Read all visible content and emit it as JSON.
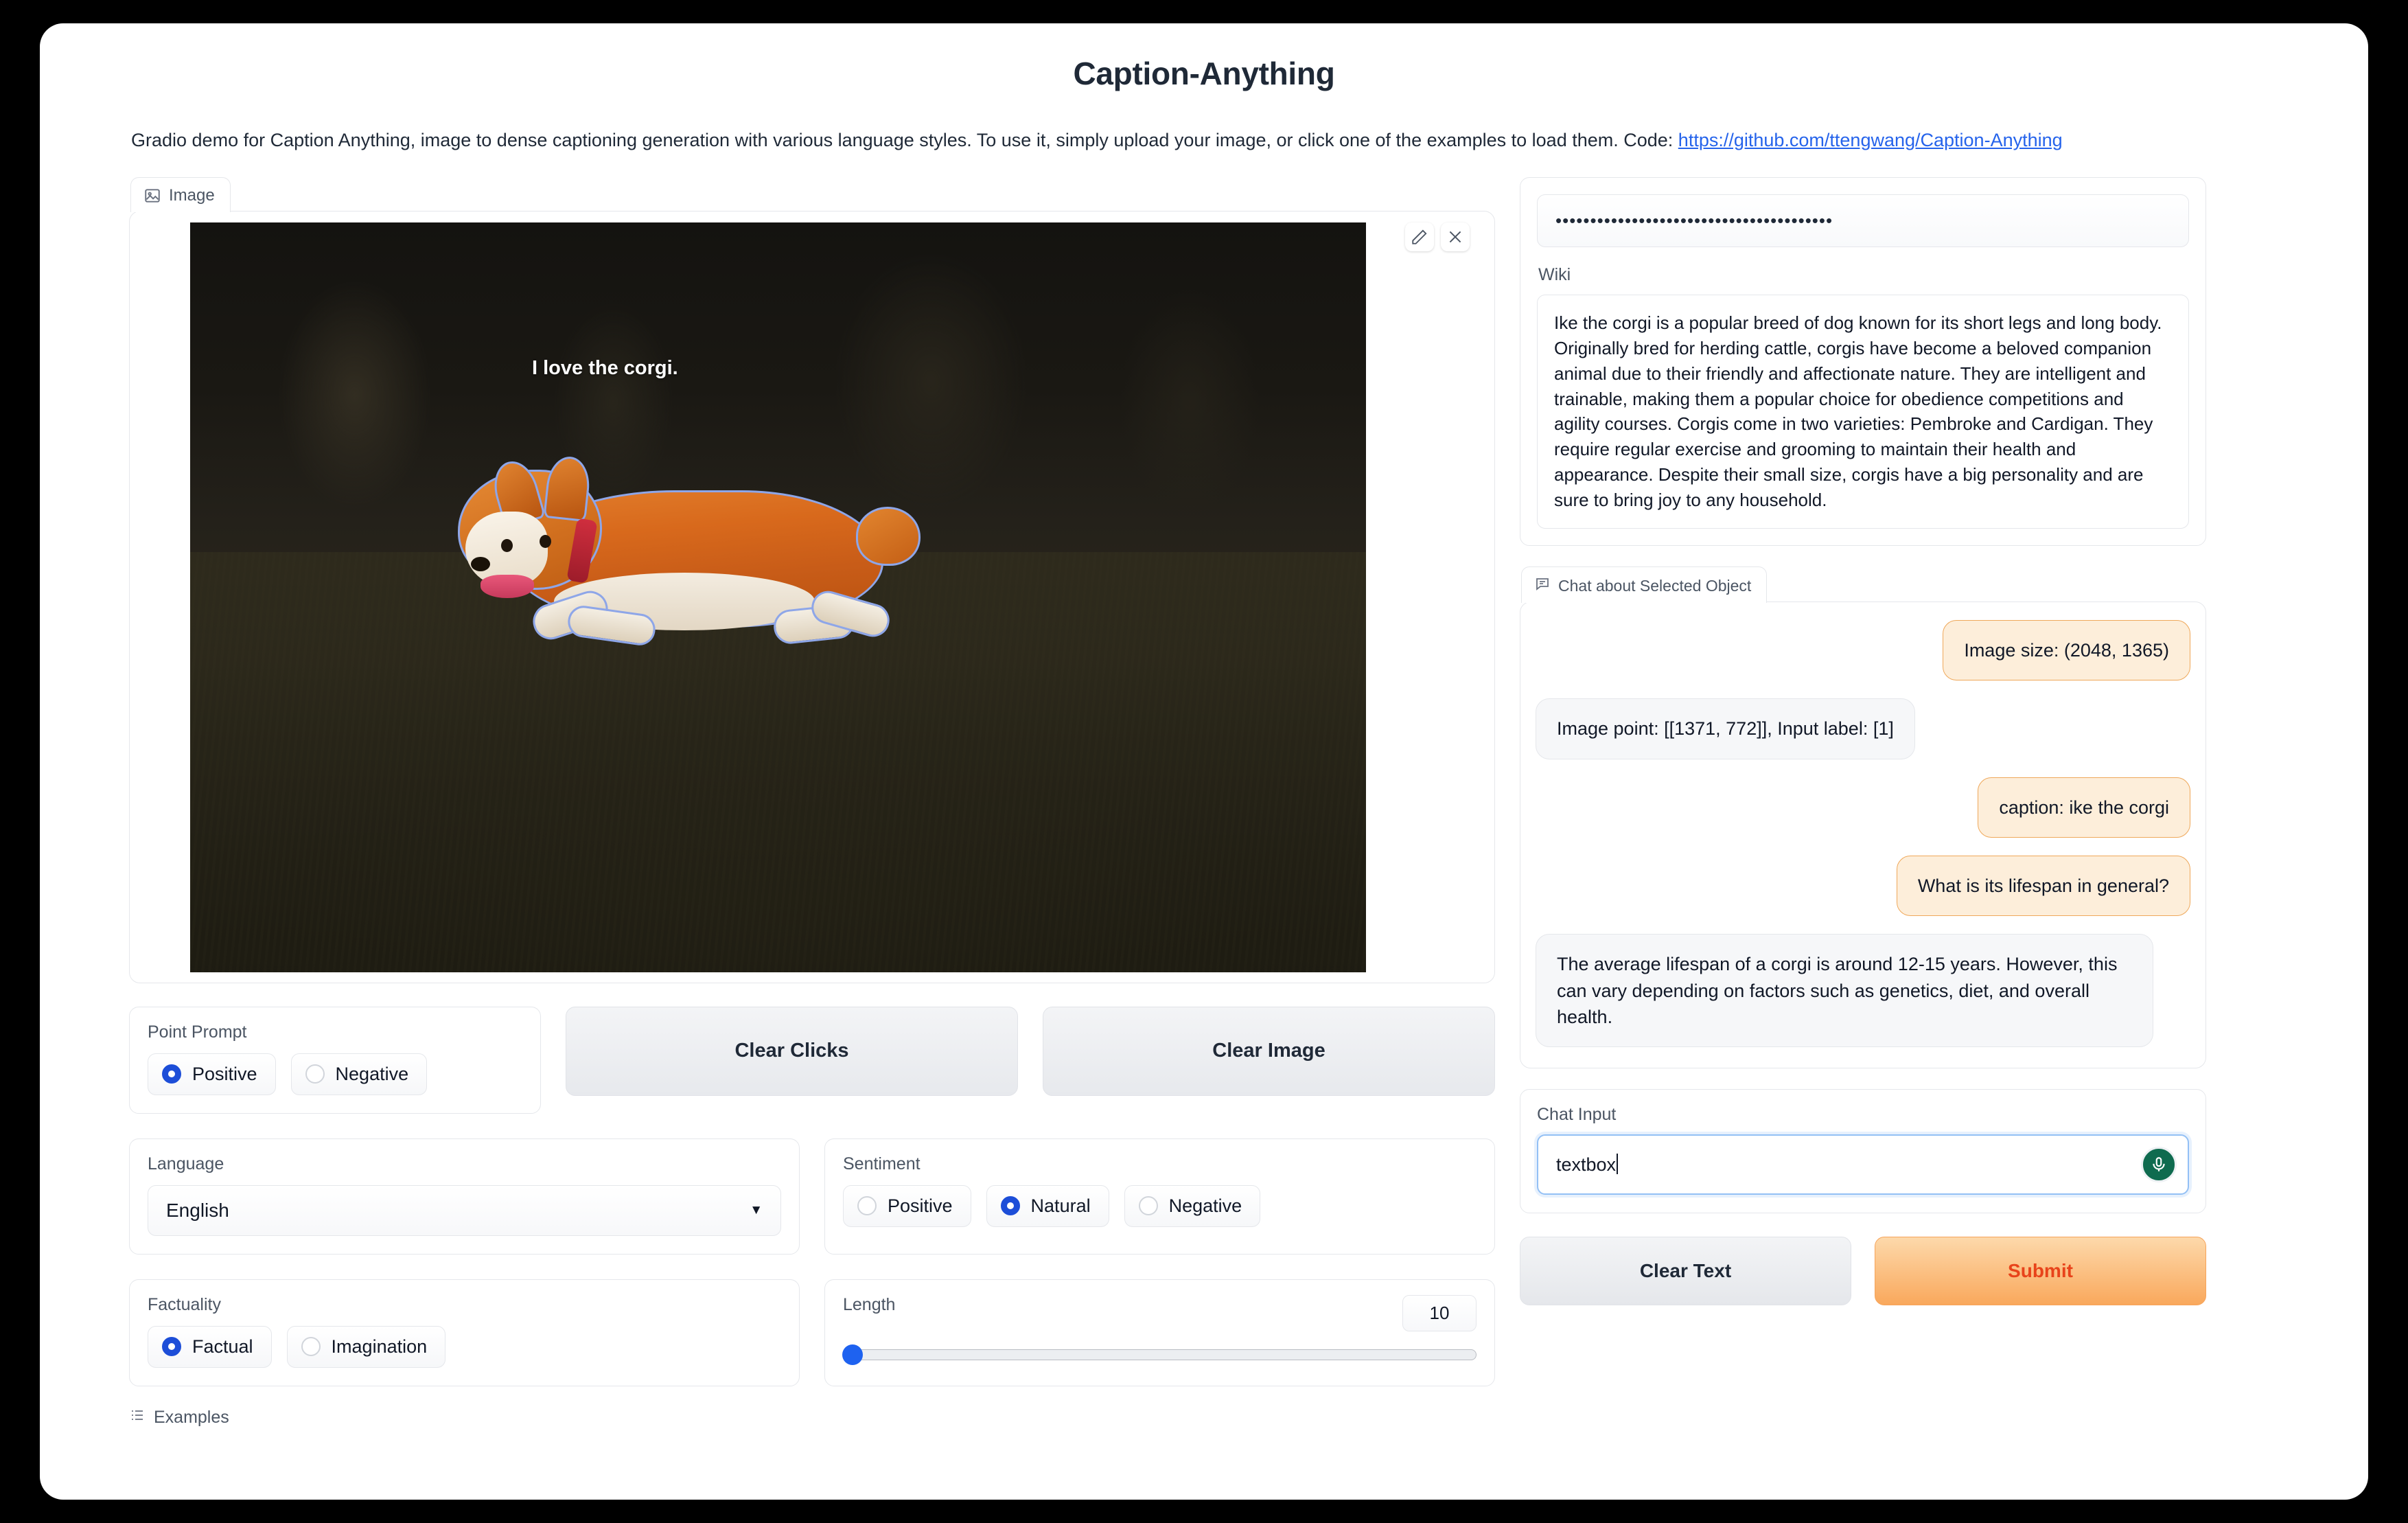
{
  "header": {
    "title": "Caption-Anything",
    "description_before": "Gradio demo for Caption Anything, image to dense captioning generation with various language styles. To use it, simply upload your image, or click one of the examples to load them. Code: ",
    "link_text": "https://github.com/ttengwang/Caption-Anything"
  },
  "image_panel": {
    "tab_label": "Image",
    "overlay_caption": "I love the corgi.",
    "edit_icon": "pencil-icon",
    "close_icon": "close-icon"
  },
  "controls": {
    "point_prompt": {
      "label": "Point Prompt",
      "options": [
        "Positive",
        "Negative"
      ],
      "selected": "Positive"
    },
    "clear_clicks_label": "Clear Clicks",
    "clear_image_label": "Clear Image",
    "language": {
      "label": "Language",
      "value": "English"
    },
    "sentiment": {
      "label": "Sentiment",
      "options": [
        "Positive",
        "Natural",
        "Negative"
      ],
      "selected": "Natural"
    },
    "factuality": {
      "label": "Factuality",
      "options": [
        "Factual",
        "Imagination"
      ],
      "selected": "Factual"
    },
    "length": {
      "label": "Length",
      "value": "10"
    },
    "examples_label": "Examples"
  },
  "right": {
    "password_value": "••••••••••••••••••••••••••••••••••••••••",
    "wiki_label": "Wiki",
    "wiki_text": "Ike the corgi is a popular breed of dog known for its short legs and long body. Originally bred for herding cattle, corgis have become a beloved companion animal due to their friendly and affectionate nature. They are intelligent and trainable, making them a popular choice for obedience competitions and agility courses. Corgis come in two varieties: Pembroke and Cardigan. They require regular exercise and grooming to maintain their health and appearance. Despite their small size, corgis have a big personality and are sure to bring joy to any household.",
    "chat_tab_label": "Chat about Selected Object",
    "messages": [
      {
        "role": "user",
        "text": "Image size: (2048, 1365)"
      },
      {
        "role": "bot",
        "text": "Image point: [[1371, 772]], Input label: [1]"
      },
      {
        "role": "user",
        "text": "caption: ike the corgi"
      },
      {
        "role": "user",
        "text": "What is its lifespan in general?"
      },
      {
        "role": "bot",
        "text": "The average lifespan of a corgi is around 12-15 years. However, this can vary depending on factors such as genetics, diet, and overall health."
      }
    ],
    "chat_input_label": "Chat Input",
    "chat_input_value": "textbox",
    "mic_icon": "microphone-icon",
    "clear_text_label": "Clear Text",
    "submit_label": "Submit"
  },
  "colors": {
    "accent_orange": "#f9a85c",
    "submit_text": "#e8431a",
    "radio_blue": "#1d4ed8",
    "link_blue": "#2563eb",
    "mic_green": "#0f6b4f"
  }
}
